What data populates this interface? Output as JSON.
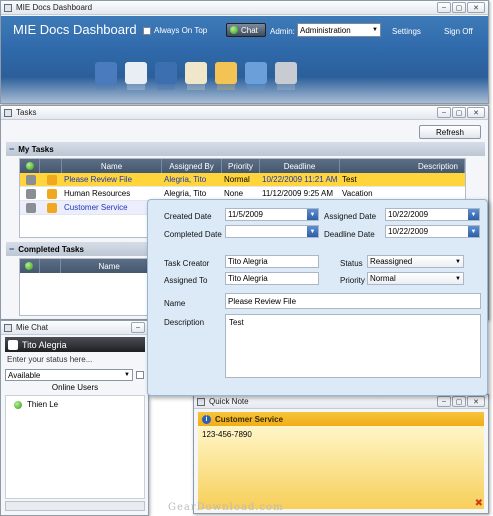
{
  "dashboard": {
    "window_title": "MIE Docs Dashboard",
    "title": "MIE Docs Dashboard",
    "always_on_top": "Always On Top",
    "chat_button": "Chat",
    "admin_label": "Admin:",
    "admin_value": "Administration",
    "settings": "Settings",
    "sign_off": "Sign Off",
    "icons": [
      {
        "name": "monitor-icon",
        "color": "#4a7bbf"
      },
      {
        "name": "document-icon",
        "color": "#e9eef5"
      },
      {
        "name": "network-icon",
        "color": "#3c6fb0"
      },
      {
        "name": "pencil-icon",
        "color": "#f0e6c9"
      },
      {
        "name": "folder-arrow-icon",
        "color": "#f3c355"
      },
      {
        "name": "computer-icon",
        "color": "#6aa0da"
      },
      {
        "name": "calculator-icon",
        "color": "#c8ccd2"
      }
    ]
  },
  "tasks": {
    "window_title": "Tasks",
    "refresh": "Refresh",
    "my_tasks": "My Tasks",
    "completed_tasks": "Completed Tasks",
    "columns": [
      "Name",
      "Assigned By",
      "Priority",
      "Deadline",
      "Description"
    ],
    "completed_columns": [
      "Name"
    ],
    "rows": [
      {
        "name": "Please Review File",
        "assigned_by": "Alegria, Tito",
        "priority": "Normal",
        "deadline": "10/22/2009 11:21 AM",
        "description": "Test"
      },
      {
        "name": "Human Resources",
        "assigned_by": "Alegria, Tito",
        "priority": "None",
        "deadline": "11/12/2009 9:25 AM",
        "description": "Vacation"
      },
      {
        "name": "Customer Service",
        "assigned_by": "",
        "priority": "",
        "deadline": "",
        "description": ""
      }
    ]
  },
  "detail": {
    "created_date_label": "Created Date",
    "created_date": "11/5/2009",
    "assigned_date_label": "Assigned Date",
    "assigned_date": "10/22/2009",
    "completed_date_label": "Completed Date",
    "completed_date": "",
    "deadline_date_label": "Deadline Date",
    "deadline_date": "10/22/2009",
    "task_creator_label": "Task Creator",
    "task_creator": "Tito Alegria",
    "status_label": "Status",
    "status": "Reassigned",
    "assigned_to_label": "Assigned To",
    "assigned_to": "Tito Alegria",
    "priority_label": "Priority",
    "priority": "Normal",
    "name_label": "Name",
    "name": "Please Review File",
    "description_label": "Description",
    "description": "Test"
  },
  "chat": {
    "window_title": "Mie Chat",
    "user": "Tito Alegria",
    "status_placeholder": "Enter your status here...",
    "availability": "Available",
    "online_users_label": "Online Users",
    "online_users": [
      "Thien Le"
    ]
  },
  "note": {
    "window_title": "Quick Note",
    "header": "Customer Service",
    "body": "123-456-7890"
  },
  "watermark": "GearDownload.com"
}
